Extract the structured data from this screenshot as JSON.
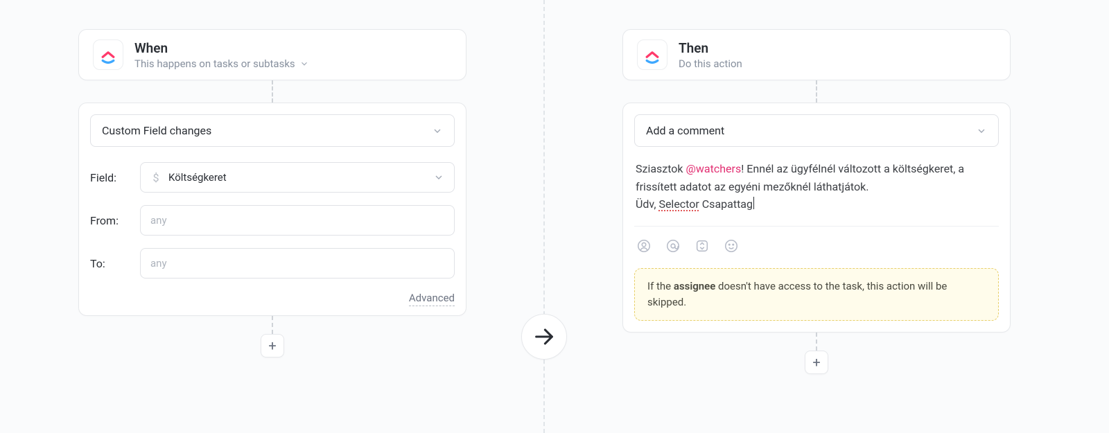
{
  "trigger": {
    "title": "When",
    "subtitle": "This happens on tasks or subtasks",
    "type_selected": "Custom Field changes",
    "field_label": "Field:",
    "field_value": "Költségkeret",
    "from_label": "From:",
    "from_placeholder": "any",
    "to_label": "To:",
    "to_placeholder": "any",
    "advanced_link": "Advanced"
  },
  "action": {
    "title": "Then",
    "subtitle": "Do this action",
    "type_selected": "Add a comment",
    "comment": {
      "pre_mention": "Sziasztok ",
      "mention": "@watchers",
      "post_mention": "! Ennél az ügyfélnél változott a költségkeret, a frissített adatot az egyéni mezőknél láthatjátok.",
      "line2_pre": "Üdv, ",
      "line2_misspell": "Selector",
      "line2_post": " Csapattag"
    },
    "warning_pre": "If the ",
    "warning_bold": "assignee",
    "warning_post": " doesn't have access to the task, this action will be skipped."
  },
  "glyphs": {
    "plus": "+"
  }
}
